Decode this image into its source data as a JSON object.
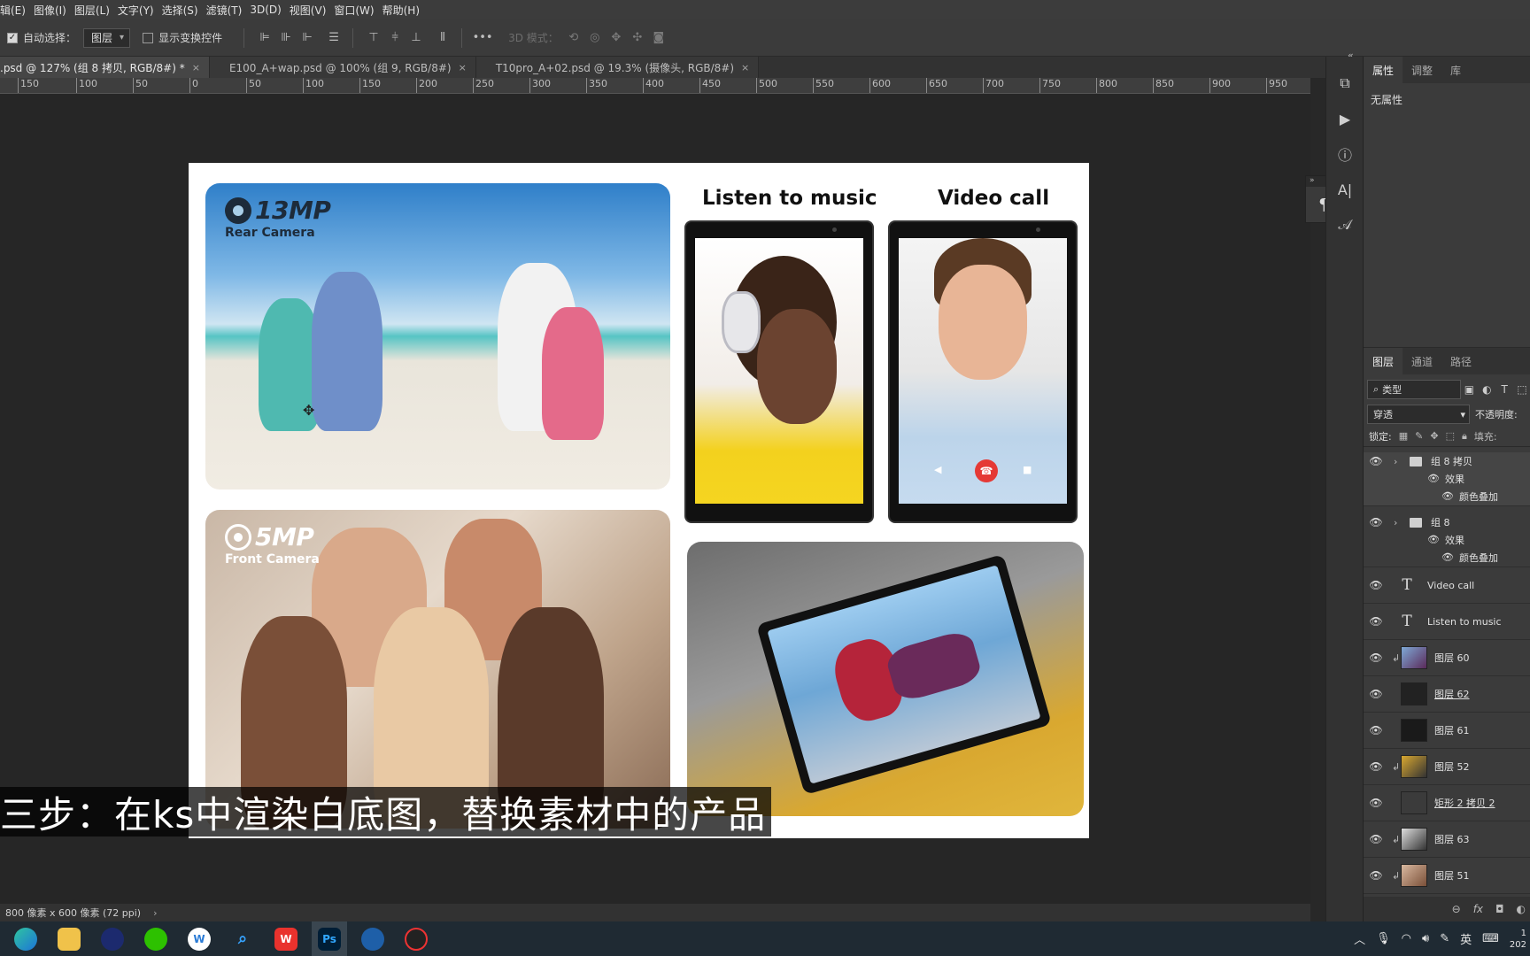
{
  "menu": [
    "辑(E)",
    "图像(I)",
    "图层(L)",
    "文字(Y)",
    "选择(S)",
    "滤镜(T)",
    "3D(D)",
    "视图(V)",
    "窗口(W)",
    "帮助(H)"
  ],
  "options": {
    "auto_select_label": "自动选择：",
    "auto_select_value": "图层",
    "show_transform_label": "显示变换控件",
    "mode_3d_label": "3D 模式："
  },
  "tabs": [
    {
      "label": ".psd @ 127% (组 8 拷贝, RGB/8#) *"
    },
    {
      "label": "E100_A+wap.psd @ 100% (组 9, RGB/8#)"
    },
    {
      "label": "T10pro_A+02.psd @ 19.3% (摄像头, RGB/8#)"
    }
  ],
  "ruler": [
    "150",
    "100",
    "50",
    "0",
    "50",
    "100",
    "150",
    "200",
    "250",
    "300",
    "350",
    "400",
    "450",
    "500",
    "550",
    "600",
    "650",
    "700",
    "750",
    "800",
    "850",
    "900",
    "950"
  ],
  "artboard": {
    "rear": {
      "title": "13MP",
      "sub": "Rear Camera"
    },
    "front": {
      "title": "5MP",
      "sub": "Front Camera"
    },
    "heading_music": "Listen to music",
    "heading_video": "Video call"
  },
  "subtitle": "三步：在ks中渲染白底图，替换素材中的产品",
  "status": "800 像素 x 600 像素 (72 ppi)",
  "properties": {
    "tabs": [
      "属性",
      "调整",
      "库"
    ],
    "empty": "无属性"
  },
  "layers_panel": {
    "tabs": [
      "图层",
      "通道",
      "路径"
    ],
    "filter": "类型",
    "blend": "穿透",
    "opacity_label": "不透明度:",
    "lock_label": "锁定:",
    "fill_label": "填充:",
    "items": [
      {
        "kind": "group",
        "name": "组 8 拷贝"
      },
      {
        "kind": "sub",
        "name": "效果"
      },
      {
        "kind": "sub2",
        "name": "颜色叠加"
      },
      {
        "kind": "group",
        "name": "组 8"
      },
      {
        "kind": "sub",
        "name": "效果"
      },
      {
        "kind": "sub2",
        "name": "颜色叠加"
      },
      {
        "kind": "text",
        "name": "Video call"
      },
      {
        "kind": "text",
        "name": "Listen to music"
      },
      {
        "kind": "image",
        "name": "图层 60"
      },
      {
        "kind": "image",
        "name": "图层 62"
      },
      {
        "kind": "image",
        "name": "图层 61"
      },
      {
        "kind": "image",
        "name": "图层 52"
      },
      {
        "kind": "image",
        "name": "矩形 2 拷贝 2"
      },
      {
        "kind": "image",
        "name": "图层 63"
      },
      {
        "kind": "image",
        "name": "图层 51"
      }
    ]
  },
  "taskbar": {
    "apps": [
      "edge",
      "explorer",
      "cinema4d",
      "wechat",
      "browser-w",
      "search-app",
      "wps",
      "photoshop",
      "keyshot",
      "recorder"
    ],
    "ime": "英",
    "clock_fragment": "1",
    "date_fragment": "202"
  },
  "colors": {
    "accent": "#1473e6",
    "ps_blue": "#31a8ff"
  }
}
